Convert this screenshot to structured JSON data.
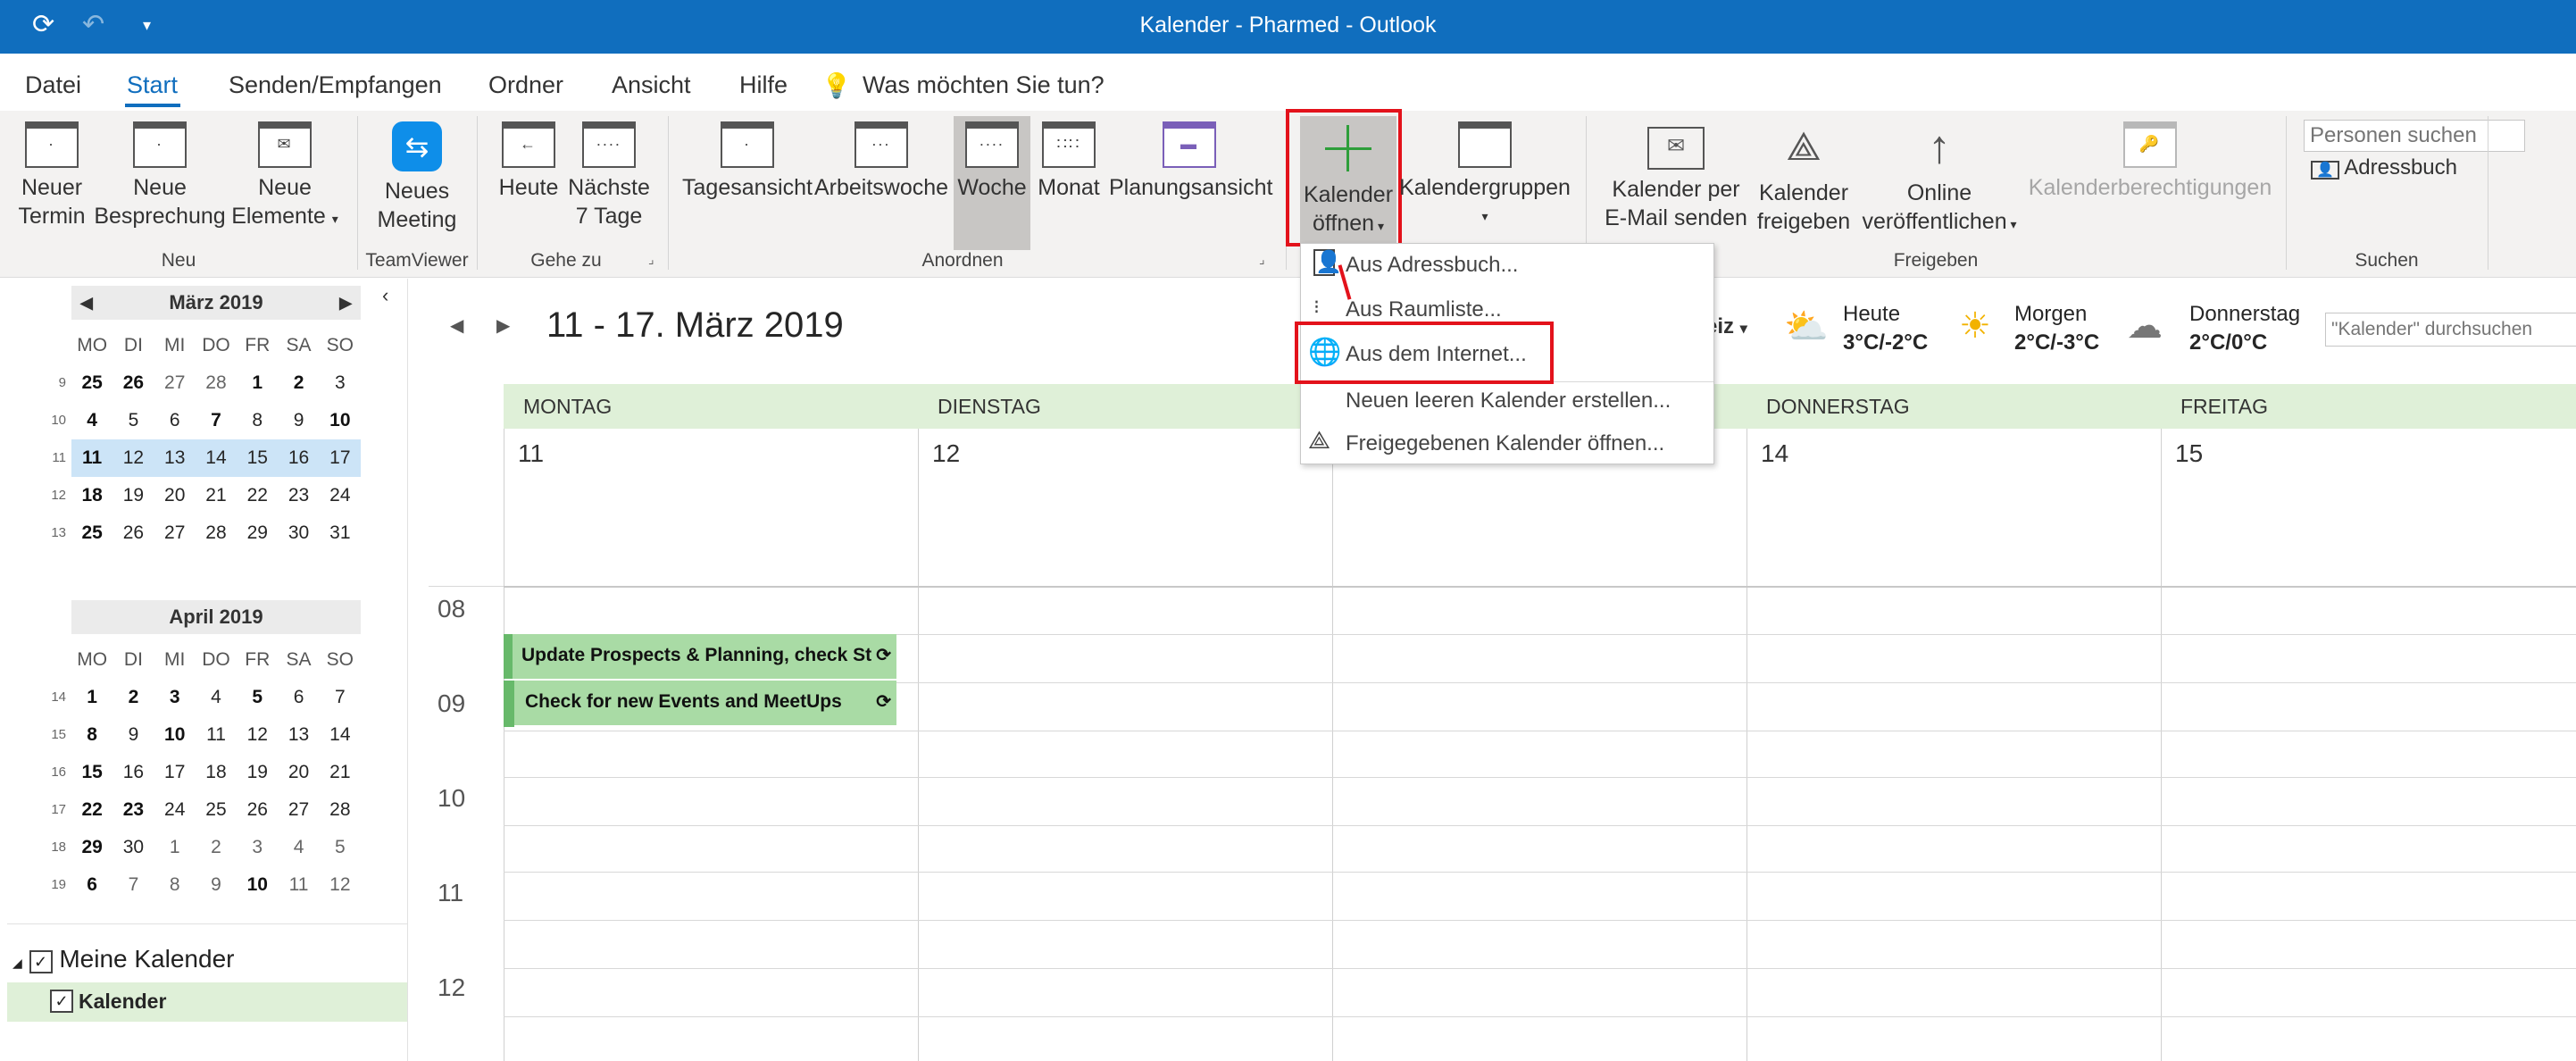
{
  "titlebar": {
    "title": "Kalender - Pharmed  -  Outlook",
    "color": "#106ebe"
  },
  "menu": {
    "tabs": [
      "Datei",
      "Start",
      "Senden/Empfangen",
      "Ordner",
      "Ansicht",
      "Hilfe"
    ],
    "tell_me": "Was möchten Sie tun?"
  },
  "ribbon": {
    "neuer_termin": [
      "Neuer",
      "Termin"
    ],
    "neue_besprechung": [
      "Neue",
      "Besprechung"
    ],
    "neue_elemente": [
      "Neue",
      "Elemente"
    ],
    "neues_meeting": [
      "Neues",
      "Meeting"
    ],
    "heute": "Heute",
    "naechste": [
      "Nächste",
      "7 Tage"
    ],
    "tagesansicht": "Tagesansicht",
    "arbeitswoche": "Arbeitswoche",
    "woche": "Woche",
    "monat": "Monat",
    "planungsansicht": "Planungsansicht",
    "kalender_oeffnen": [
      "Kalender",
      "öffnen"
    ],
    "kalendergruppen": "Kalendergruppen",
    "kalender_per_email": [
      "Kalender per",
      "E-Mail senden"
    ],
    "kalender_freigeben": [
      "Kalender",
      "freigeben"
    ],
    "online": [
      "Online",
      "veröffentlichen"
    ],
    "kalenderberechtigungen": "Kalenderberechtigungen",
    "personen_suchen": "Personen suchen",
    "adressbuch": "Adressbuch",
    "groups": {
      "neu": "Neu",
      "teamviewer": "TeamViewer",
      "gehe_zu": "Gehe zu",
      "anordnen": "Anordnen",
      "freigeben": "Freigeben",
      "suchen": "Suchen"
    }
  },
  "dropdown": {
    "items": [
      "Aus Adressbuch...",
      "Aus Raumliste...",
      "Aus dem Internet...",
      "Neuen leeren Kalender erstellen...",
      "Freigegebenen Kalender öffnen..."
    ]
  },
  "minical": {
    "dow": [
      "MO",
      "DI",
      "MI",
      "DO",
      "FR",
      "SA",
      "SO"
    ],
    "march": {
      "title": "März 2019",
      "weeks": [
        "9",
        "10",
        "11",
        "12",
        "13"
      ],
      "rows": [
        [
          "25",
          "26",
          "27",
          "28",
          "1",
          "2",
          "3"
        ],
        [
          "4",
          "5",
          "6",
          "7",
          "8",
          "9",
          "10"
        ],
        [
          "11",
          "12",
          "13",
          "14",
          "15",
          "16",
          "17"
        ],
        [
          "18",
          "19",
          "20",
          "21",
          "22",
          "23",
          "24"
        ],
        [
          "25",
          "26",
          "27",
          "28",
          "29",
          "30",
          "31"
        ]
      ]
    },
    "april": {
      "title": "April 2019",
      "weeks": [
        "14",
        "15",
        "16",
        "17",
        "18",
        "19"
      ],
      "rows": [
        [
          "1",
          "2",
          "3",
          "4",
          "5",
          "6",
          "7"
        ],
        [
          "8",
          "9",
          "10",
          "11",
          "12",
          "13",
          "14"
        ],
        [
          "15",
          "16",
          "17",
          "18",
          "19",
          "20",
          "21"
        ],
        [
          "22",
          "23",
          "24",
          "25",
          "26",
          "27",
          "28"
        ],
        [
          "29",
          "30",
          "1",
          "2",
          "3",
          "4",
          "5"
        ],
        [
          "6",
          "7",
          "8",
          "9",
          "10",
          "11",
          "12"
        ]
      ]
    }
  },
  "folders": {
    "group": "Meine Kalender",
    "item": "Kalender"
  },
  "main": {
    "range_title": "11 - 17. März 2019",
    "location_partial": "eiz",
    "days": [
      {
        "name": "MONTAG",
        "num": "11"
      },
      {
        "name": "DIENSTAG",
        "num": "12"
      },
      {
        "name": "",
        "num": ""
      },
      {
        "name": "DONNERSTAG",
        "num": "14"
      },
      {
        "name": "FREITAG",
        "num": "15"
      }
    ],
    "hours": [
      "08",
      "09",
      "10",
      "11",
      "12"
    ],
    "events": [
      "Update Prospects & Planning, check St",
      "Check for new Events and MeetUps"
    ],
    "search_placeholder": "\"Kalender\" durchsuchen"
  },
  "weather": [
    {
      "day": "Heute",
      "temp": "3°C/-2°C",
      "icon": "sun-cloud-icon"
    },
    {
      "day": "Morgen",
      "temp": "2°C/-3°C",
      "icon": "sun-icon"
    },
    {
      "day": "Donnerstag",
      "temp": "2°C/0°C",
      "icon": "cloud-icon"
    }
  ]
}
